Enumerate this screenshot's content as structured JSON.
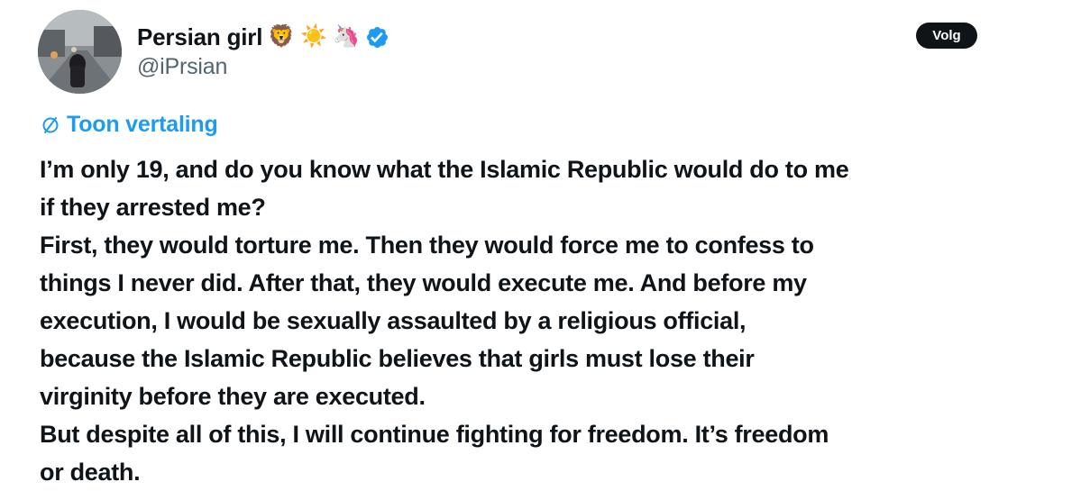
{
  "author": {
    "display_name": "Persian girl",
    "emojis": [
      "🦁",
      "☀️",
      "🦄"
    ],
    "handle": "@iPrsian",
    "verified_icon": "verified-badge-icon",
    "verified_color": "#1d9bf0"
  },
  "follow_button": {
    "label": "Volg"
  },
  "translate": {
    "icon": "translate-icon",
    "label": "Toon vertaling",
    "color": "#1d9bf0"
  },
  "tweet": {
    "lines": [
      "I’m only 19, and do you know what the Islamic Republic would do to me",
      "if they arrested me?",
      "First, they would torture me. Then they would force me to confess to",
      "things I never did. After that, they would execute me. And before my",
      "execution, I would be sexually assaulted by a religious official,",
      "because the Islamic Republic believes that girls must lose their",
      "virginity before they are executed.",
      "But despite all of this, I will continue fighting for freedom. It’s freedom",
      "or death."
    ]
  }
}
